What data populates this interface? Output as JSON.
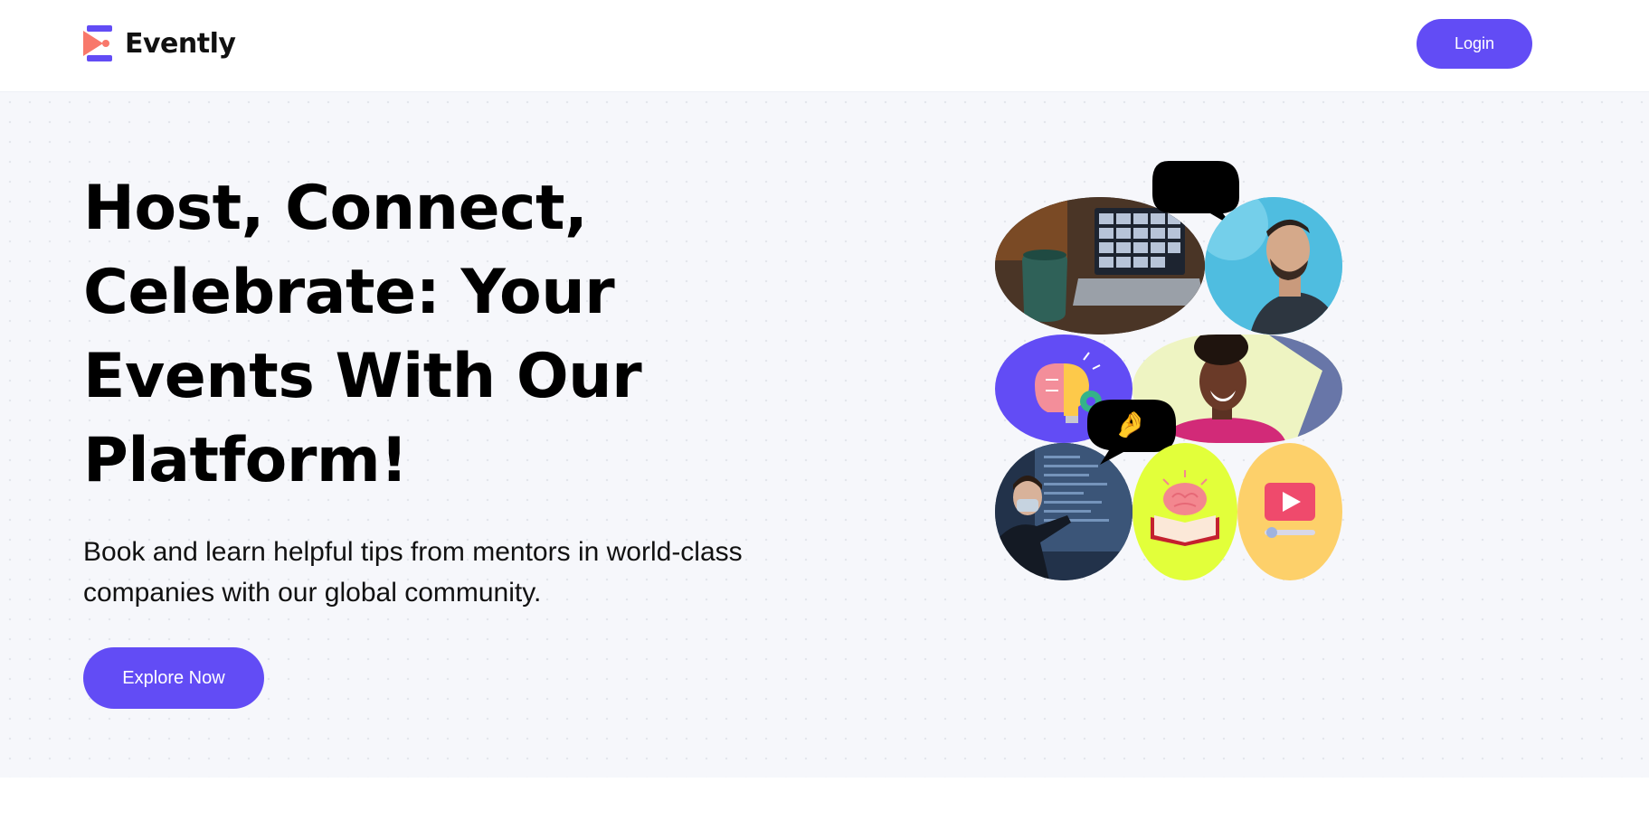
{
  "brand": {
    "name": "Evently",
    "accent_color": "#624cf5",
    "logo_icon": "evently-logo-icon"
  },
  "header": {
    "login_label": "Login"
  },
  "hero": {
    "title": "Host, Connect, Celebrate: Your Events With Our Platform!",
    "subtitle": "Book and learn helpful tips from mentors in world-class companies with our global community.",
    "cta_label": "Explore Now"
  },
  "collage": {
    "items": [
      {
        "name": "laptop-video-call-photo"
      },
      {
        "name": "smiling-man-photo"
      },
      {
        "name": "brain-lightbulb-illustration"
      },
      {
        "name": "laughing-woman-photo"
      },
      {
        "name": "presenter-classroom-photo"
      },
      {
        "name": "brain-book-illustration"
      },
      {
        "name": "video-player-illustration"
      }
    ],
    "bubble_top_emoji": "😍",
    "bubble_mid_emoji": "🤌"
  }
}
